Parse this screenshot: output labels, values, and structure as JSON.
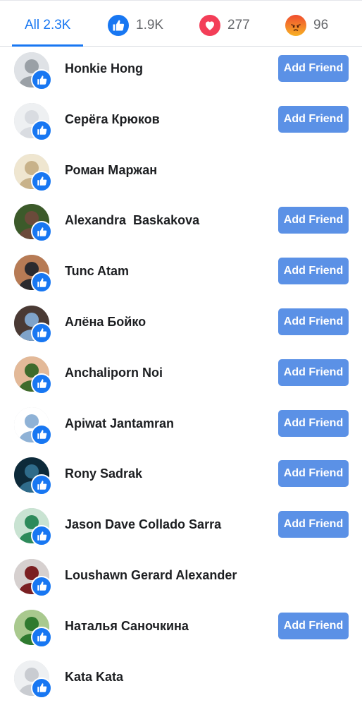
{
  "tabs": [
    {
      "label": "All 2.3K",
      "icon": null
    },
    {
      "label": "1.9K",
      "icon": "like-reaction-icon"
    },
    {
      "label": "277",
      "icon": "love-reaction-icon"
    },
    {
      "label": "96",
      "icon": "angry-reaction-icon"
    }
  ],
  "colors": {
    "accent": "#1877f2",
    "button": "#5b91e6",
    "love": "#f33e58",
    "angry": "#f7b125"
  },
  "add_friend_label": "Add Friend",
  "people": [
    {
      "name": "Honkie Hong",
      "show_button": true
    },
    {
      "name": "Серёга Крюков",
      "show_button": true
    },
    {
      "name": "Роман Маржан",
      "show_button": false
    },
    {
      "name": "Alexandra  Baskakova",
      "show_button": true
    },
    {
      "name": "Tunc Atam",
      "show_button": true
    },
    {
      "name": "Алёна Бойко",
      "show_button": true
    },
    {
      "name": "Anchaliporn Noi",
      "show_button": true
    },
    {
      "name": "Apiwat Jantamran",
      "show_button": true
    },
    {
      "name": "Rony Sadrak",
      "show_button": true
    },
    {
      "name": "Jason Dave Collado Sarra",
      "show_button": true
    },
    {
      "name": "Loushawn Gerard Alexander",
      "show_button": false
    },
    {
      "name": "Наталья Саночкина",
      "show_button": true
    },
    {
      "name": "Kata Kata",
      "show_button": false
    }
  ]
}
